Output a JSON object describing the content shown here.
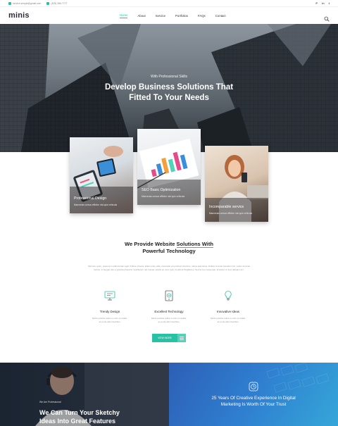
{
  "topbar": {
    "email": "service.simple@gmail.com",
    "phone": "(405) 366-7777",
    "social": [
      "P",
      "in",
      "t"
    ]
  },
  "nav": {
    "logo": "minis",
    "items": [
      {
        "label": "Home",
        "active": true
      },
      {
        "label": "About"
      },
      {
        "label": "Service"
      },
      {
        "label": "Portfolios"
      },
      {
        "label": "FAQs"
      },
      {
        "label": "Contact"
      }
    ]
  },
  "hero": {
    "eyebrow": "With Professional Skills",
    "title_line1": "Develop Business Solutions That",
    "title_line2": "Fitted To Your Needs"
  },
  "cards": [
    {
      "title": "Professional Design",
      "desc": "Maecenas cursus efficitur nisl quis vehicula"
    },
    {
      "title": "SEO Basic Optimization",
      "desc": "Maecenas cursus efficitur nisl quis vehicula"
    },
    {
      "title": "Incomparable service",
      "desc": "Maecenas cursus efficitur nisl quis vehicula"
    }
  ],
  "provide": {
    "title_pre": "We Provide Website ",
    "title_hl": "Solutions With",
    "title_line2": "Powerful Technology",
    "body": "Sed sem justo, posuere in ullamcorper eget, finibus ut lacus. Etiam odio nulla, venenatis vel pulvinar interdum, varius quis lacus. Nullam at amet interdum nisi, varius sit amet lacinia. In feugiat odio a gravida pharetra. Vestibulum nisl massa, iaculis eu nunc quis, hendrerit fringilla leo. Sed ac leo consequat, tincidunt mi sed, aliquam arc."
  },
  "features": [
    {
      "title": "Trendy Design",
      "desc_line1": "Morbi porttitor tellus in enim convallis,",
      "desc_line2": "ac porta diam faucibus."
    },
    {
      "title": "Excellent Technology",
      "desc_line1": "Morbi porttitor tellus in enim convallis,",
      "desc_line2": "ac porta diam faucibus."
    },
    {
      "title": "Innovative Ideas",
      "desc_line1": "Morbi porttitor tellus in enim convallis,",
      "desc_line2": "ac porta diam faucibus."
    }
  ],
  "view_more": {
    "label": "VIEW MORE"
  },
  "bottom": {
    "left_eyebrow": "We Are Professional",
    "left_title_line1": "We Can Turn Your  Sketchy",
    "left_title_line2": "Ideas Into Great Features",
    "right_title_line1": "25 Years Of Creative Experience In Digital",
    "right_title_line2": "Marketing Is Worth Of Your Trust"
  },
  "colors": {
    "accent": "#27c2a4",
    "dark_text": "#222222",
    "muted_text": "#999999"
  }
}
